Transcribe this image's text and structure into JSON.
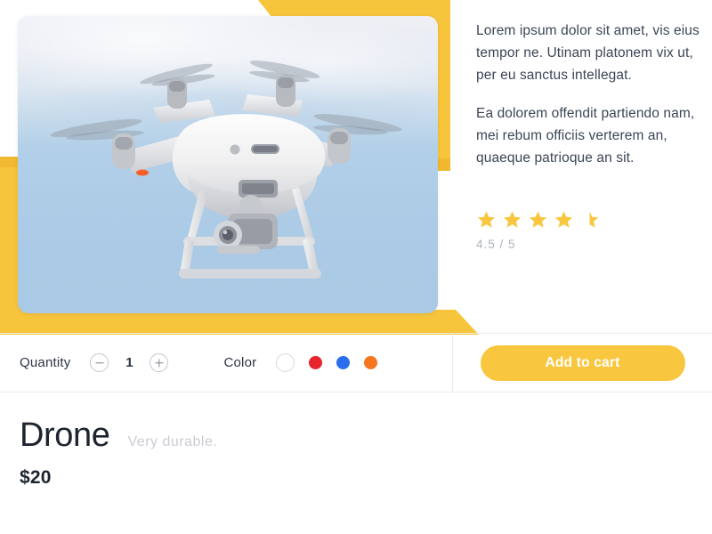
{
  "product": {
    "title": "Drone",
    "tagline": "Very durable.",
    "price": "$20",
    "image_alt": "white quadcopter drone flying in a blue sky"
  },
  "description": {
    "paragraph_1": "Lorem ipsum dolor sit amet, vis eius tempor ne. Utinam platonem vix ut, per eu sanctus intellegat.",
    "paragraph_2": "Ea dolorem offendit partiendo nam, mei rebum officiis verterem an, quaeque patrioque an sit."
  },
  "rating": {
    "value": 4.5,
    "max": 5,
    "label": "4.5 / 5",
    "full_stars": 4,
    "half_stars": 1,
    "star_color": "#f9c73f"
  },
  "options": {
    "quantity": {
      "label": "Quantity",
      "value": "1",
      "decrement_icon": "minus-circle-icon",
      "increment_icon": "plus-circle-icon"
    },
    "color": {
      "label": "Color",
      "swatches": [
        {
          "name": "white",
          "hex": "#ffffff",
          "selected": true
        },
        {
          "name": "red",
          "hex": "#e8242c",
          "selected": false
        },
        {
          "name": "blue",
          "hex": "#2a6ef0",
          "selected": false
        },
        {
          "name": "orange",
          "hex": "#f5761e",
          "selected": false
        }
      ]
    }
  },
  "cart": {
    "button_label": "Add to cart",
    "button_color": "#f9c73f",
    "button_text_color": "#ffffff"
  },
  "theme": {
    "accent": "#f7c53c",
    "accent_shadow": "#f0b92f",
    "text_primary": "#1d2430",
    "text_body": "#3c4656",
    "text_muted": "#aeb4bf",
    "divider": "#e9eaec",
    "background": "#ffffff"
  }
}
